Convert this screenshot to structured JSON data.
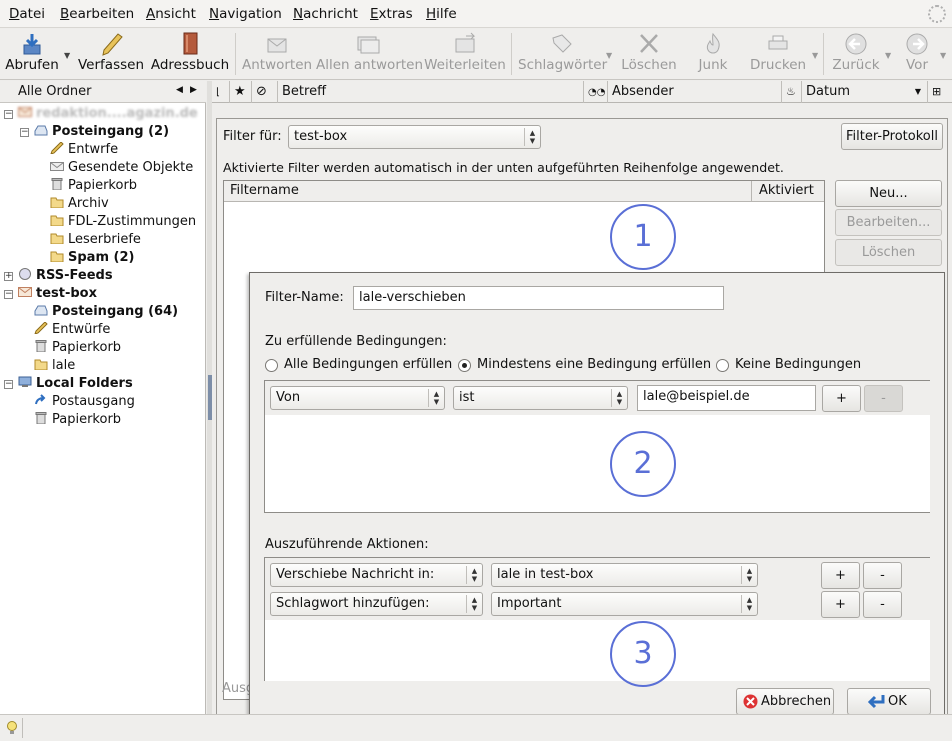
{
  "menu": [
    "Datei",
    "Bearbeiten",
    "Ansicht",
    "Navigation",
    "Nachricht",
    "Extras",
    "Hilfe"
  ],
  "menu_underline": [
    "D",
    "B",
    "A",
    "N",
    "N",
    "E",
    "H"
  ],
  "toolbar": {
    "abrufen": "Abrufen",
    "verfassen": "Verfassen",
    "adressbuch": "Adressbuch",
    "antworten": "Antworten",
    "allen_antworten": "Allen antworten",
    "weiterleiten": "Weiterleiten",
    "schlagwoerter": "Schlagwörter",
    "loeschen": "Löschen",
    "junk": "Junk",
    "drucken": "Drucken",
    "zurueck": "Zurück",
    "vor": "Vor"
  },
  "folder_pane": {
    "header": "Alle Ordner",
    "account1": "redaktion....agazin.de",
    "posteingang1": "Posteingang (2)",
    "entwrfe": "Entwrfe",
    "gesendete": "Gesendete Objekte",
    "papierkorb1": "Papierkorb",
    "archiv": "Archiv",
    "fdl": "FDL-Zustimmungen",
    "leserbriefe": "Leserbriefe",
    "spam": "Spam (2)",
    "rss": "RSS-Feeds",
    "testbox": "test-box",
    "posteingang2": "Posteingang (64)",
    "entwuerfe": "Entwürfe",
    "papierkorb2": "Papierkorb",
    "lale": "lale",
    "local": "Local Folders",
    "postausgang": "Postausgang",
    "papierkorb3": "Papierkorb"
  },
  "columns": {
    "betreff": "Betreff",
    "absender": "Absender",
    "datum": "Datum"
  },
  "filter_dialog": {
    "filter_fuer_label": "Filter für:",
    "filter_fuer_value": "test-box",
    "protokoll": "Filter-Protokoll",
    "info": "Aktivierte Filter werden automatisch in der unten aufgeführten Reihenfolge angewendet.",
    "col_name": "Filtername",
    "col_aktiv": "Aktiviert",
    "neu": "Neu...",
    "bearbeiten": "Bearbeiten...",
    "loeschen": "Löschen",
    "bottom_partial": "Ausg"
  },
  "rule_dialog": {
    "name_label": "Filter-Name:",
    "name_value": "lale-verschieben",
    "conditions_label": "Zu erfüllende Bedingungen:",
    "radio_all": "Alle Bedingungen erfüllen",
    "radio_any": "Mindestens eine Bedingung erfüllen",
    "radio_none": "Keine Bedingungen",
    "cond_field": "Von",
    "cond_op": "ist",
    "cond_value": "lale@beispiel.de",
    "actions_label": "Auszuführende Aktionen:",
    "action1": "Verschiebe Nachricht in:",
    "action1_target": "lale in test-box",
    "action2": "Schlagwort hinzufügen:",
    "action2_target": "Important",
    "plus": "+",
    "minus": "-",
    "cancel": "Abbrechen",
    "ok": "OK"
  },
  "annotations": [
    "1",
    "2",
    "3"
  ],
  "colors": {
    "annotation": "#5a6fd6",
    "selection": "#7d8ea8"
  }
}
